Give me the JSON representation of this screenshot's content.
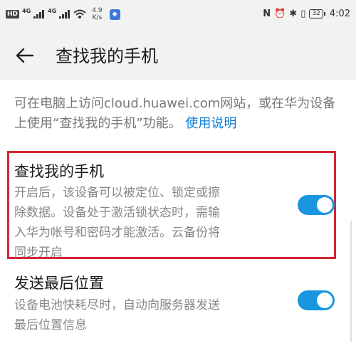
{
  "status_bar": {
    "hd": "HD",
    "net1": "4G",
    "net2": "4G",
    "speed_value": "4.9",
    "speed_unit": "K/s",
    "battery": "32",
    "time": "4:02"
  },
  "header": {
    "title": "查找我的手机"
  },
  "description": {
    "text": "可在电脑上访问cloud.huawei.com网站，或在华为设备上使用“查找我的手机”功能。",
    "link": "使用说明"
  },
  "settings": [
    {
      "title": "查找我的手机",
      "line1": "开启后，该设备可以被定位、锁定或擦",
      "line2": "除数据。设备处于激活锁状态时，需输",
      "line3": "入华为帐号和密码才能激活。云备份将",
      "line4": "同步开启",
      "enabled": true
    },
    {
      "title": "发送最后位置",
      "line1": "设备电池快耗尽时，自动向服务器发送",
      "line2": "最后位置信息",
      "enabled": true
    }
  ],
  "colors": {
    "accent": "#1a96e0",
    "link": "#0a7ed6",
    "highlight": "#d32734"
  }
}
